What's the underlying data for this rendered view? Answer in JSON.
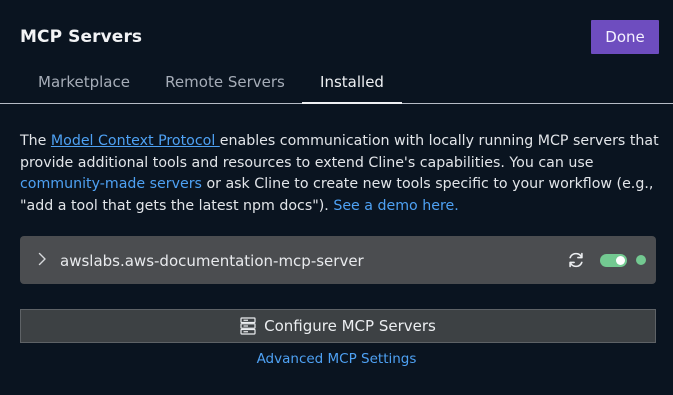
{
  "header": {
    "title": "MCP Servers",
    "done_label": "Done"
  },
  "tabs": [
    {
      "label": "Marketplace",
      "active": false
    },
    {
      "label": "Remote Servers",
      "active": false
    },
    {
      "label": "Installed",
      "active": true
    }
  ],
  "description": {
    "prefix": "The ",
    "protocol_link": "Model Context Protocol ",
    "mid1": "enables communication with locally running MCP servers that provide additional tools and resources to extend Cline's capabilities. You can use ",
    "community_link": "community-made servers",
    "mid2": " or ask Cline to create new tools specific to your workflow (e.g., \"add a tool that gets the latest npm docs\"). ",
    "demo_link": "See a demo here."
  },
  "servers": [
    {
      "name": "awslabs.aws-documentation-mcp-server",
      "enabled": true,
      "status": "connected",
      "expand_icon": "chevron-right-icon",
      "restart_icon": "refresh-icon"
    }
  ],
  "configure": {
    "label": "Configure MCP Servers",
    "icon": "server-icon"
  },
  "advanced_link": "Advanced MCP Settings",
  "colors": {
    "background": "#0a1420",
    "accent_button": "#6e4dbf",
    "link": "#4ea1f3",
    "status_green": "#73c991",
    "server_row_bg": "#4b4d50"
  }
}
